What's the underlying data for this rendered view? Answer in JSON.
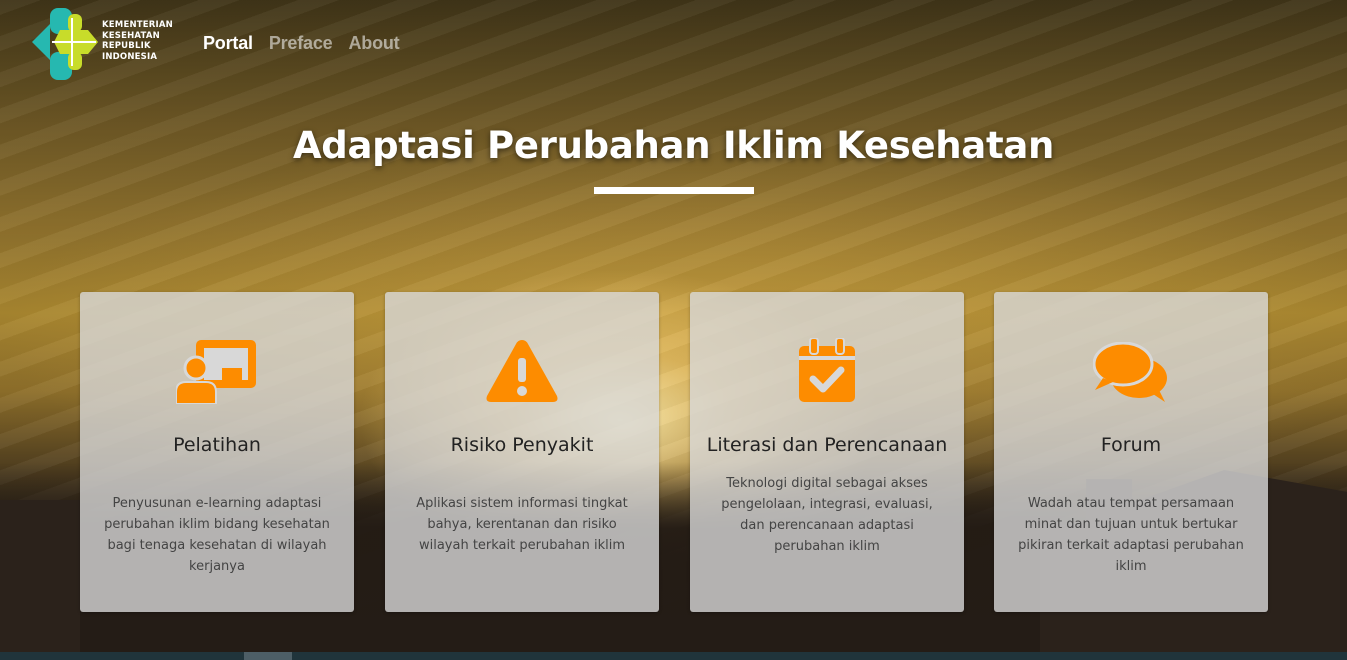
{
  "logo": {
    "lines": [
      "KEMENTERIAN",
      "KESEHATAN",
      "REPUBLIK",
      "INDONESIA"
    ],
    "colors": {
      "teal": "#26b8b0",
      "lime": "#c8dc2a"
    }
  },
  "nav": [
    {
      "label": "Portal",
      "active": true
    },
    {
      "label": "Preface",
      "active": false
    },
    {
      "label": "About",
      "active": false
    }
  ],
  "hero": {
    "title": "Adaptasi Perubahan Iklim Kesehatan"
  },
  "accent_color": "#fd8c00",
  "cards": [
    {
      "icon": "teacher-board-icon",
      "title": "Pelatihan",
      "description": "Penyusunan e-learning adaptasi perubahan iklim bidang kesehatan bagi tenaga kesehatan di wilayah kerjanya"
    },
    {
      "icon": "warning-triangle-icon",
      "title": "Risiko Penyakit",
      "description": "Aplikasi sistem informasi tingkat bahya, kerentanan dan risiko wilayah terkait perubahan iklim"
    },
    {
      "icon": "calendar-check-icon",
      "title": "Literasi dan Perencanaan",
      "description": "Teknologi digital sebagai akses pengelolaan, integrasi, evaluasi, dan perencanaan adaptasi perubahan iklim"
    },
    {
      "icon": "comments-icon",
      "title": "Forum",
      "description": "Wadah atau tempat persamaan minat dan tujuan untuk bertukar pikiran terkait adaptasi perubahan iklim"
    }
  ]
}
